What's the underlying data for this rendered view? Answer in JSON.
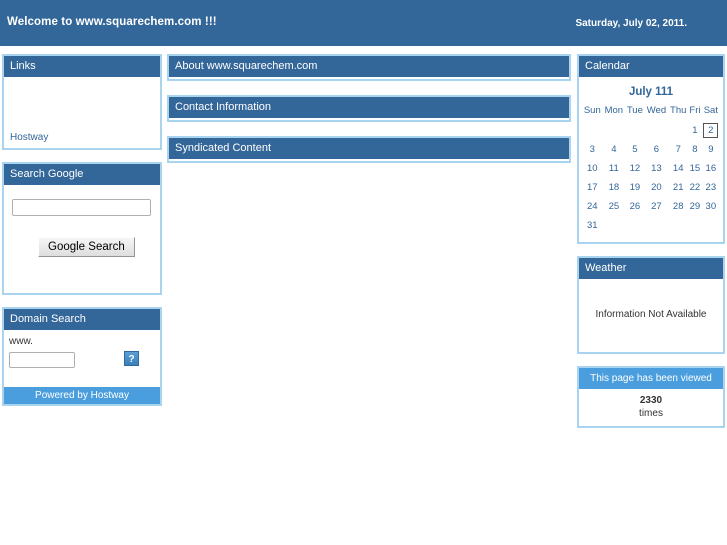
{
  "banner": {
    "title": "Welcome to www.squarechem.com !!!",
    "date": "Saturday, July 02, 2011."
  },
  "left": {
    "links_panel": {
      "header": "Links",
      "items": [
        {
          "label": "Hostway"
        }
      ]
    },
    "search_google_panel": {
      "header": "Search Google",
      "input_value": "",
      "input_placeholder": "",
      "button_label": "Google Search"
    },
    "domain_search_panel": {
      "header": "Domain Search",
      "prefix_label": "www.",
      "input_value": "",
      "input_placeholder": "",
      "submit_icon": "broken-image-icon",
      "submit_glyph": "?",
      "footer": "Powered by Hostway"
    }
  },
  "center": {
    "panels": [
      {
        "header": "About www.squarechem.com"
      },
      {
        "header": "Contact Information"
      },
      {
        "header": "Syndicated Content"
      }
    ]
  },
  "right": {
    "calendar_panel": {
      "header": "Calendar",
      "title": "July 111",
      "weekdays": [
        "Sun",
        "Mon",
        "Tue",
        "Wed",
        "Thu",
        "Fri",
        "Sat"
      ],
      "weeks": [
        [
          "",
          "",
          "",
          "",
          "",
          "1",
          "2"
        ],
        [
          "3",
          "4",
          "5",
          "6",
          "7",
          "8",
          "9"
        ],
        [
          "10",
          "11",
          "12",
          "13",
          "14",
          "15",
          "16"
        ],
        [
          "17",
          "18",
          "19",
          "20",
          "21",
          "22",
          "23"
        ],
        [
          "24",
          "25",
          "26",
          "27",
          "28",
          "29",
          "30"
        ],
        [
          "31",
          "",
          "",
          "",
          "",
          "",
          ""
        ]
      ],
      "today": "2"
    },
    "weather_panel": {
      "header": "Weather",
      "message": "Information Not Available"
    },
    "counter_panel": {
      "header": "This page has been viewed",
      "value": "2330",
      "label": "times"
    }
  },
  "colors": {
    "banner_blue": "#336699",
    "header_blue": "#336699",
    "light_blue": "#4a9ede",
    "panel_border": "#a8d4f0",
    "link_blue": "#336699"
  }
}
